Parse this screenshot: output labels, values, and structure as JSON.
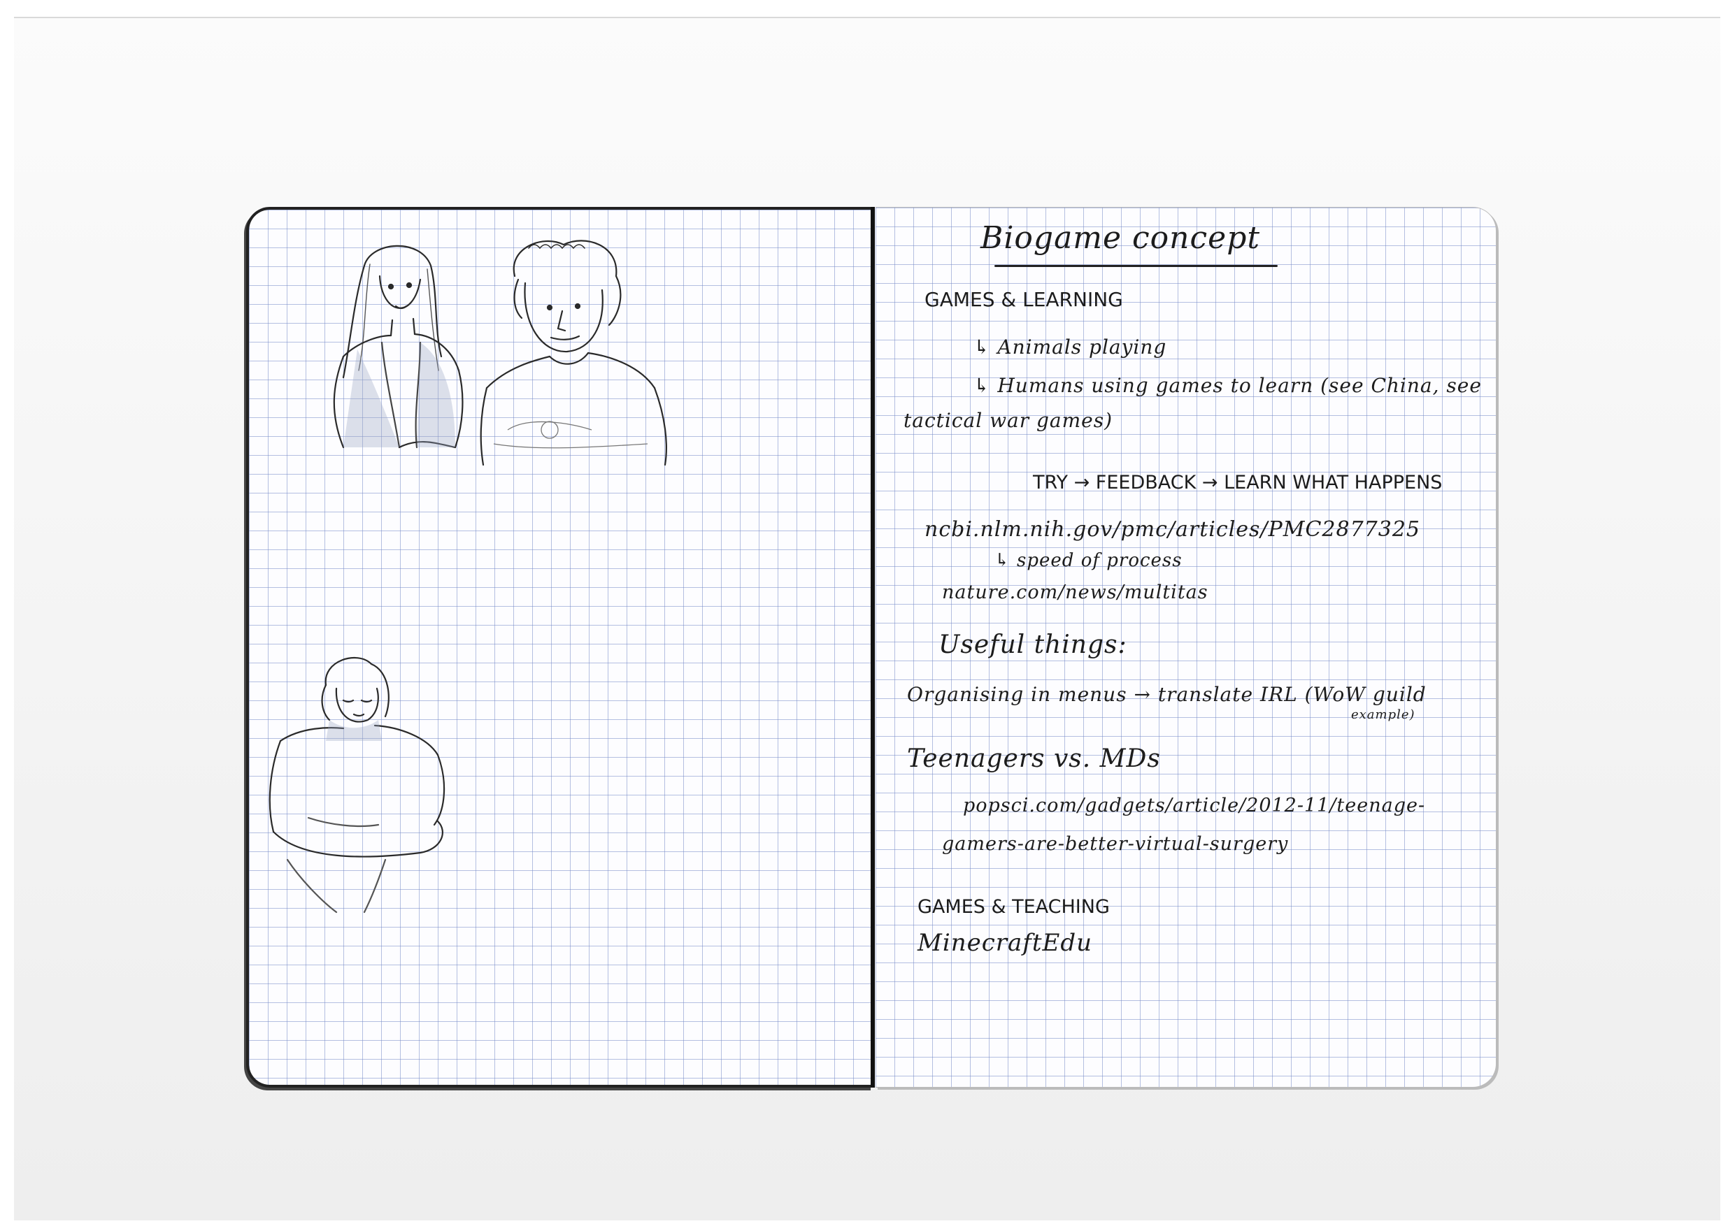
{
  "notebook": {
    "right_page": {
      "title": "Biogame concept",
      "lines": [
        "GAMES & LEARNING",
        "↳ Animals playing",
        "↳ Humans using games to learn (see China, see",
        "tactical war games)",
        "TRY → FEEDBACK → LEARN WHAT HAPPENS",
        "ncbi.nlm.nih.gov/pmc/articles/PMC2877325",
        "↳ speed of process",
        "nature.com/news/multitas",
        "Useful things:",
        "Organising in menus → translate IRL (WoW guild",
        "example)",
        "Teenagers vs. MDs",
        "popsci.com/gadgets/article/2012-11/teenage-",
        "gamers-are-better-virtual-surgery",
        "GAMES & TEACHING",
        "MinecraftEdu"
      ]
    },
    "left_page": {
      "sketches": [
        "sketch-girl-long-hair",
        "sketch-curly-haired-man",
        "sketch-seated-person-looking-down"
      ]
    }
  }
}
